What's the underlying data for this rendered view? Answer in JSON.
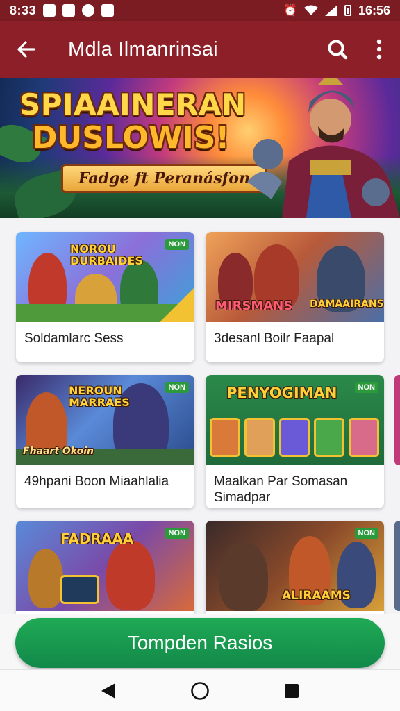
{
  "status_bar": {
    "time": "8:33",
    "right_text": "16:56",
    "icons": [
      "notification-icon",
      "mail-icon",
      "shield-icon",
      "home-icon",
      "alarm-icon",
      "wifi-icon",
      "signal-icon",
      "battery-icon"
    ]
  },
  "app_bar": {
    "title": "Mdla Ilmanrinsai",
    "back_icon": "arrow-left-icon",
    "search_icon": "search-icon",
    "more_icon": "more-vertical-icon"
  },
  "hero": {
    "title_line1": "SPIAAINERAN",
    "title_line2": "DUSLOWIS!",
    "subtitle": "Fadge ft Peranásfon"
  },
  "cards": [
    {
      "image_title": "NOROU\nDURBAIDES",
      "label": "Soldamlarc Sess",
      "badge": "NON"
    },
    {
      "image_title": "MIRSMANS",
      "image_title2": "DAMAAIRANS",
      "label": "3desanl Boilr Faapal",
      "badge": ""
    },
    {
      "image_title": "NEROUN\nMARRAES",
      "label": "49hpani Boon Miaahlalia",
      "badge": "NON",
      "image_caption": "Fhaart Okoin"
    },
    {
      "image_title": "PENYOGIMAN",
      "label": "Maalkan Par Somasan Simadpar",
      "badge": "NON"
    },
    {
      "image_title": "FADRAAA",
      "label": "",
      "badge": "NON"
    },
    {
      "image_title": "ALIRAAMS",
      "label": "",
      "badge": "NON"
    }
  ],
  "cta": {
    "label": "Tompden Rasios"
  },
  "nav": {
    "back_icon": "triangle-back-icon",
    "home_icon": "circle-home-icon",
    "recents_icon": "square-recents-icon"
  },
  "colors": {
    "status_bar": "#7a1c22",
    "app_bar": "#8c1f27",
    "cta": "#1a9a50",
    "background": "#f3f3f5"
  }
}
